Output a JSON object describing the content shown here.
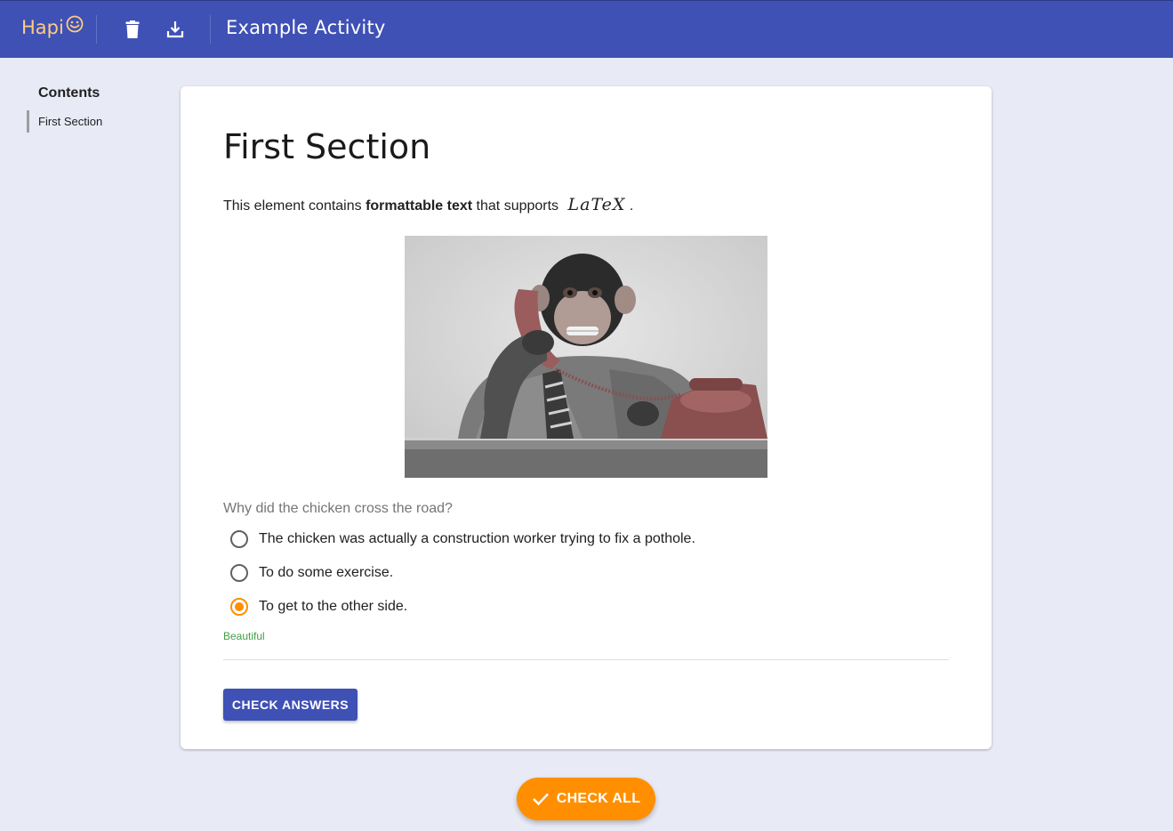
{
  "header": {
    "logo_text": "Hapi",
    "logo_icon": "smiley-face-icon",
    "delete_icon": "trash-icon",
    "download_icon": "download-icon",
    "title": "Example Activity",
    "colors": {
      "bar": "#3f51b5",
      "logo": "#ffcc80"
    }
  },
  "sidebar": {
    "title": "Contents",
    "items": [
      {
        "label": "First Section"
      }
    ]
  },
  "section": {
    "title": "First Section",
    "text_before": "This element contains ",
    "text_bold": "formattable text",
    "text_after": " that supports ",
    "latex": "LaTeX",
    "text_end": ".",
    "image_subject": "chimpanzee in shirt and tie talking on a rotary telephone",
    "question": "Why did the chicken cross the road?",
    "options": [
      {
        "label": "The chicken was actually a construction worker trying to fix a pothole.",
        "selected": false
      },
      {
        "label": "To do some exercise.",
        "selected": false
      },
      {
        "label": "To get to the other side.",
        "selected": true
      }
    ],
    "feedback": "Beautiful",
    "check_button": "CHECK ANSWERS"
  },
  "fab": {
    "label": "CHECK ALL",
    "icon": "checkmark-icon",
    "color": "#ff8f00"
  }
}
